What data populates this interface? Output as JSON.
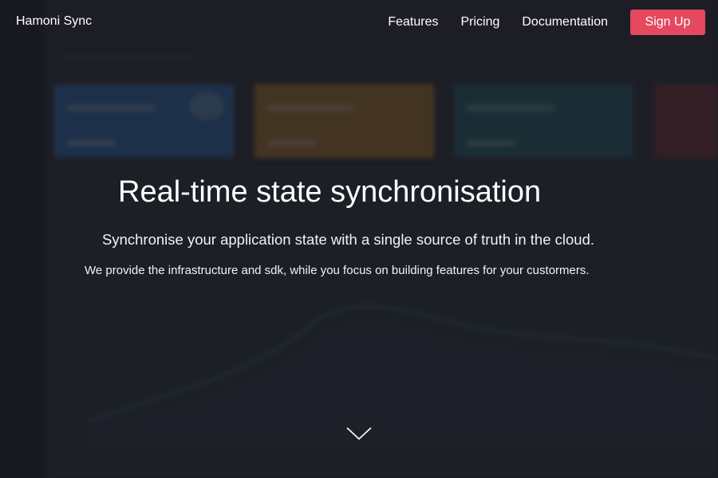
{
  "header": {
    "brand": "Hamoni Sync",
    "nav": [
      {
        "label": "Features"
      },
      {
        "label": "Pricing"
      },
      {
        "label": "Documentation"
      }
    ],
    "signup_label": "Sign Up"
  },
  "hero": {
    "title": "Real-time state synchronisation",
    "subtitle": "Synchronise your application state with a single source of truth in the cloud.",
    "description": "We provide the infrastructure and sdk, while you focus on building features for your custormers."
  },
  "colors": {
    "accent": "#e5485f",
    "card_blue": "#2e6db4",
    "card_orange": "#b57a2a",
    "card_teal": "#23606c",
    "card_red": "#7a2f35"
  },
  "icons": {
    "scroll_down": "chevron-down-icon"
  }
}
